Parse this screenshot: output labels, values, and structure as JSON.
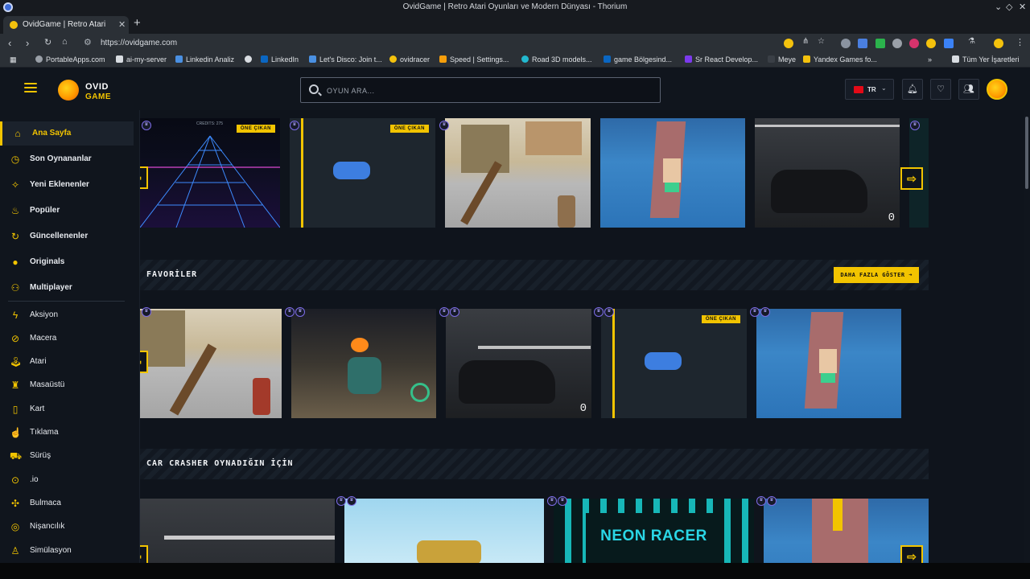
{
  "browser": {
    "window_title": "OvidGame | Retro Atari Oyunları ve Modern Dünyası - Thorium",
    "tab_title": "OvidGame | Retro Atari Oy",
    "url": "https://ovidgame.com",
    "bookmarks": [
      "PortableApps.com",
      "ai-my-server",
      "Linkedin Analiz",
      "LinkedIn",
      "Let's Disco: Join t...",
      "ovidracer",
      "Speed | Settings...",
      "Road 3D models...",
      "game Bölgesind...",
      "Sr React Develop...",
      "Meye",
      "Yandex Games fo..."
    ],
    "bookmarks_folder": "Tüm Yer İşaretleri"
  },
  "header": {
    "logo_line1": "OVID",
    "logo_line2": "GAME",
    "search_placeholder": "OYUN ARA...",
    "language": "TR"
  },
  "sidebar": {
    "main_items": [
      {
        "label": "Ana Sayfa",
        "icon": "home-icon"
      },
      {
        "label": "Son Oynananlar",
        "icon": "clock-icon"
      },
      {
        "label": "Yeni Eklenenler",
        "icon": "sparkle-icon"
      },
      {
        "label": "Popüler",
        "icon": "fire-icon"
      },
      {
        "label": "Güncellenenler",
        "icon": "refresh-icon"
      },
      {
        "label": "Originals",
        "icon": "ovid-ball-icon"
      },
      {
        "label": "Multiplayer",
        "icon": "users-icon"
      }
    ],
    "categories": [
      {
        "label": "Aksiyon",
        "icon": "bolt-icon"
      },
      {
        "label": "Macera",
        "icon": "compass-icon"
      },
      {
        "label": "Atari",
        "icon": "joystick-icon"
      },
      {
        "label": "Masaüstü",
        "icon": "chess-icon"
      },
      {
        "label": "Kart",
        "icon": "card-icon"
      },
      {
        "label": "Tıklama",
        "icon": "pointer-icon"
      },
      {
        "label": "Sürüş",
        "icon": "car-icon"
      },
      {
        "label": ".io",
        "icon": "io-icon"
      },
      {
        "label": "Bulmaca",
        "icon": "puzzle-icon"
      },
      {
        "label": "Nişancılık",
        "icon": "target-icon"
      },
      {
        "label": "Simülasyon",
        "icon": "person-icon"
      }
    ]
  },
  "main": {
    "featured_badge": "ÖNE ÇIKAN",
    "credits_text": "CREDITS: 275",
    "zero_text": "0",
    "neon_title": "NEON RACER",
    "sections": [
      {
        "title": "FAVORİLER",
        "more_label": "DAHA FAZLA GÖSTER ➜"
      },
      {
        "title": "CAR CRASHER OYNADIĞIN İÇİN"
      }
    ]
  }
}
